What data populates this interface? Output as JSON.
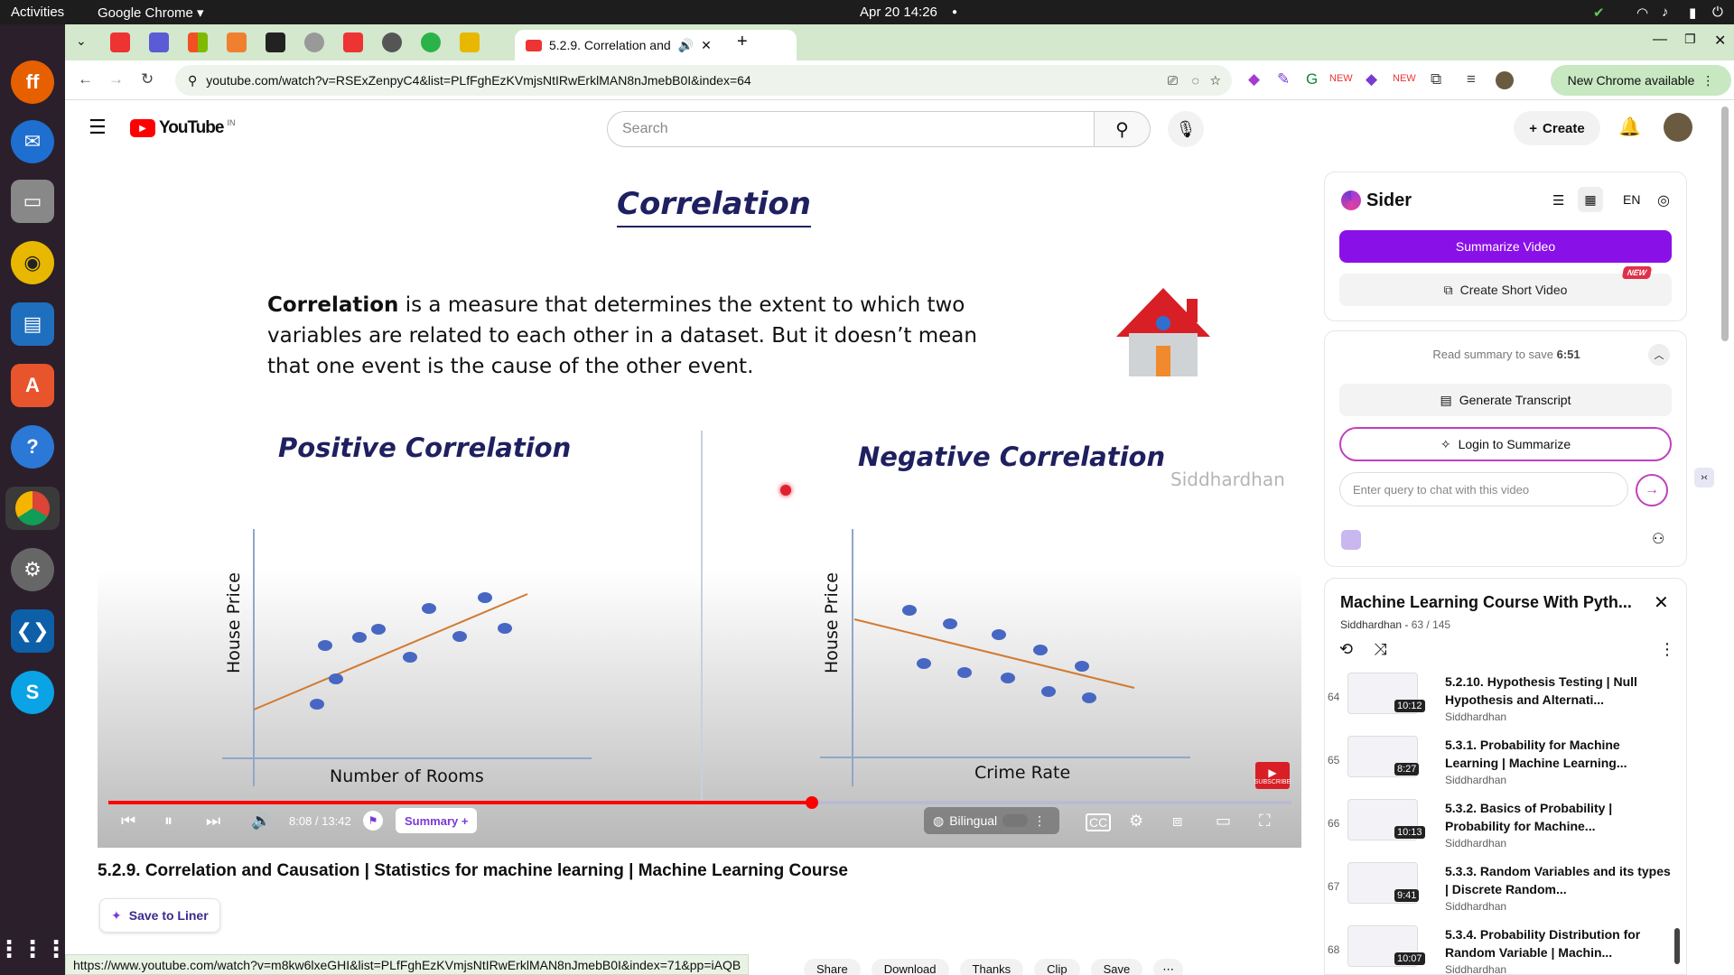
{
  "topbar": {
    "activities": "Activities",
    "app": "Google Chrome",
    "datetime": "Apr 20  14:26"
  },
  "tabs": {
    "active_title": "5.2.9. Correlation and"
  },
  "address": {
    "url": "youtube.com/watch?v=RSExZenpyC4&list=PLfFghEzKVmjsNtIRwErklMAN8nJmebB0I&index=64",
    "new_chrome": "New Chrome available"
  },
  "youtube": {
    "logo": "YouTube",
    "region": "IN",
    "search_placeholder": "Search",
    "create": "Create"
  },
  "slide": {
    "title": "Correlation",
    "definition_bold": "Correlation",
    "definition_line1": " is a measure that determines the extent to which two",
    "definition_line2": "variables are related to each other in a dataset. But it doesn’t mean",
    "definition_line3": "that one event is the cause of the other event.",
    "pos_title": "Positive Correlation",
    "neg_title": "Negative Correlation",
    "watermark": "Siddhardhan",
    "pos_ylabel": "House Price",
    "pos_xlabel": "Number of Rooms",
    "neg_ylabel": "House Price",
    "neg_xlabel": "Crime Rate",
    "subscribe": "SUBSCRIBE"
  },
  "player": {
    "time": "8:08 / 13:42",
    "summary": "Summary +",
    "bilingual": "Bilingual",
    "progress": 0.595
  },
  "video": {
    "title": "5.2.9. Correlation and Causation | Statistics for machine learning | Machine Learning Course",
    "save_liner": "Save to Liner"
  },
  "actions": [
    "Share",
    "Download",
    "Thanks",
    "Clip",
    "Save"
  ],
  "sider": {
    "brand": "Sider",
    "lang": "EN",
    "summarize": "Summarize Video",
    "short": "Create Short Video",
    "new_badge": "NEW",
    "save_note": "Read summary to save",
    "save_time": "6:51",
    "transcript": "Generate Transcript",
    "login": "Login to Summarize",
    "chat_placeholder": "Enter query to chat with this video"
  },
  "playlist": {
    "title": "Machine Learning Course With Pyth...",
    "channel": "Siddhardhan",
    "position": "63 / 145",
    "items": [
      {
        "num": "64",
        "duration": "10:12",
        "title": "5.2.10. Hypothesis Testing | Null Hypothesis and Alternati...",
        "channel": "Siddhardhan"
      },
      {
        "num": "65",
        "duration": "8:27",
        "title": "5.3.1. Probability for Machine Learning | Machine Learning...",
        "channel": "Siddhardhan"
      },
      {
        "num": "66",
        "duration": "10:13",
        "title": "5.3.2. Basics of Probability | Probability for Machine...",
        "channel": "Siddhardhan"
      },
      {
        "num": "67",
        "duration": "9:41",
        "title": "5.3.3. Random Variables and its types | Discrete Random...",
        "channel": "Siddhardhan"
      },
      {
        "num": "68",
        "duration": "10:07",
        "title": "5.3.4. Probability Distribution for Random Variable | Machin...",
        "channel": "Siddhardhan"
      }
    ]
  },
  "status_url": "https://www.youtube.com/watch?v=m8kw6lxeGHI&list=PLfFghEzKVmjsNtIRwErklMAN8nJmebB0I&index=71&pp=iAQB"
}
